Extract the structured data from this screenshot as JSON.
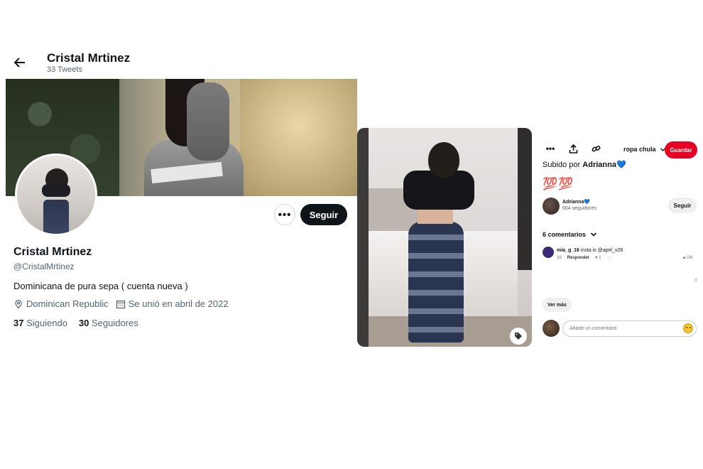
{
  "twitter": {
    "header_name": "Cristal Mrtinez",
    "tweet_count": "33 Tweets",
    "follow_label": "Seguir",
    "more_label": "•••",
    "display_name": "Cristal Mrtinez",
    "handle": "@CristalMrtinez",
    "bio": "Dominicana de pura sepa ( cuenta nueva )",
    "location": "Dominican Republic",
    "joined": "Se unió en abril de 2022",
    "following_count": "37",
    "following_label": "Siguiendo",
    "followers_count": "30",
    "followers_label": "Seguidores"
  },
  "pinterest": {
    "more_label": "•••",
    "board": "ropa chula",
    "save_label": "Guardar",
    "uploaded_prefix": "Subido por",
    "uploader": "Adrianna💙",
    "description": "💯💯",
    "owner_name": "Adrianna💙",
    "owner_followers": "604 seguidores",
    "follow_label": "Seguir",
    "comments_label": "6 comentarios",
    "comment": {
      "user": "mia_g_16",
      "text": "insta is @april_v28",
      "time": "3d",
      "reply_label": "Responder",
      "likes": "1",
      "more": "···",
      "useful": "Útil"
    },
    "dot": "8",
    "see_more_label": "Ver más",
    "comment_placeholder": "Añade un comentario"
  },
  "colors": {
    "twitter_dark": "#0f1419",
    "twitter_secondary": "#536471",
    "pinterest_red": "#e60023"
  }
}
